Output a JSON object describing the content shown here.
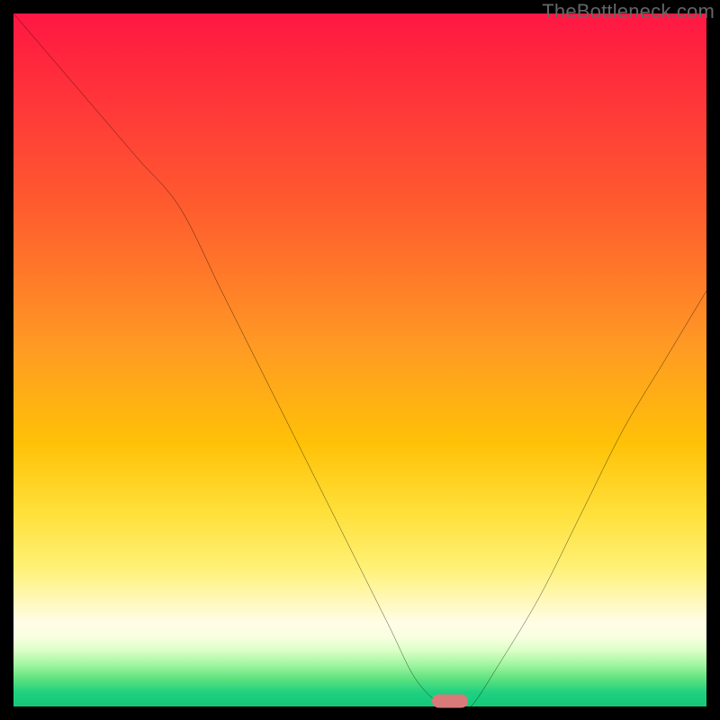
{
  "watermark": "TheBottleneck.com",
  "colors": {
    "frame": "#000000",
    "curve": "#000000",
    "marker": "#d87a7a",
    "gradient_top": "#ff1744",
    "gradient_mid": "#ffc107",
    "gradient_bottom": "#15c979"
  },
  "chart_data": {
    "type": "line",
    "title": "",
    "xlabel": "",
    "ylabel": "",
    "xlim": [
      0,
      100
    ],
    "ylim": [
      0,
      100
    ],
    "grid": false,
    "legend": false,
    "series": [
      {
        "name": "bottleneck-curve",
        "x": [
          0,
          6,
          12,
          18,
          24,
          30,
          36,
          42,
          48,
          54,
          58,
          62,
          64,
          66,
          70,
          76,
          82,
          88,
          94,
          100
        ],
        "values": [
          100,
          93,
          86,
          79,
          72,
          60,
          48,
          36,
          24,
          12,
          4,
          0,
          0,
          0,
          6,
          16,
          28,
          40,
          50,
          60
        ]
      }
    ],
    "annotations": [
      {
        "name": "optimal-marker",
        "x": 63,
        "y": 0,
        "shape": "pill",
        "color": "#d87a7a"
      }
    ]
  }
}
